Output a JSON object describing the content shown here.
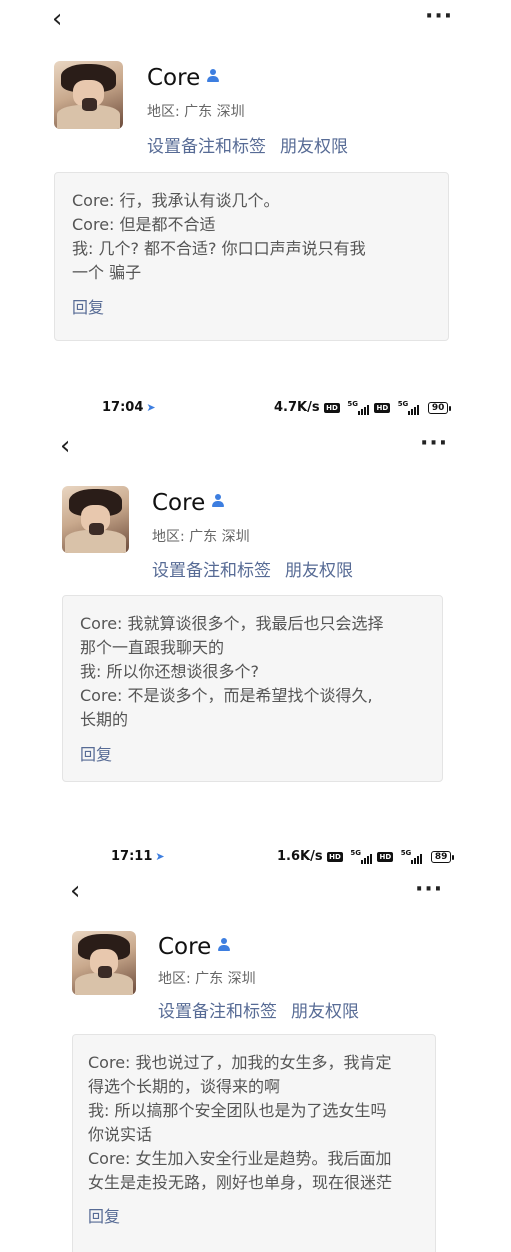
{
  "panels": [
    {
      "contact": {
        "name": "Core",
        "region": "地区: 广东  深圳",
        "set_remark": "设置备注和标签",
        "friend_permissions": "朋友权限"
      },
      "messages": [
        "Core: 行，我承认有谈几个。",
        "Core: 但是都不合适",
        "我: 几个? 都不合适? 你口口声声说只有我",
        "一个 骗子"
      ],
      "reply": "回复"
    },
    {
      "status": {
        "time": "17:04",
        "speed": "4.7K/s",
        "battery": "90"
      },
      "contact": {
        "name": "Core",
        "region": "地区: 广东  深圳",
        "set_remark": "设置备注和标签",
        "friend_permissions": "朋友权限"
      },
      "messages": [
        "Core: 我就算谈很多个，我最后也只会选择",
        "那个一直跟我聊天的",
        "我: 所以你还想谈很多个?",
        "Core: 不是谈多个，而是希望找个谈得久,",
        "长期的"
      ],
      "reply": "回复"
    },
    {
      "status": {
        "time": "17:11",
        "speed": "1.6K/s",
        "battery": "89"
      },
      "contact": {
        "name": "Core",
        "region": "地区: 广东  深圳",
        "set_remark": "设置备注和标签",
        "friend_permissions": "朋友权限"
      },
      "messages": [
        "Core: 我也说过了，加我的女生多，我肯定",
        "得选个长期的，谈得来的啊",
        "我: 所以搞那个安全团队也是为了选女生吗",
        "你说实话",
        "Core: 女生加入安全行业是趋势。我后面加",
        "女生是走投无路，刚好也单身，现在很迷茫"
      ],
      "reply": "回复"
    }
  ],
  "icons": {
    "back": "chevron-left-icon",
    "more": "more-dots-icon",
    "contact": "person-icon",
    "location": "location-arrow-icon",
    "signal": "signal-icon",
    "battery": "battery-icon"
  },
  "accent_colors": {
    "link": "#576b95",
    "person_icon": "#3d7ee0",
    "card_bg": "#f6f6f6"
  },
  "labels": {
    "more_dots": "···",
    "back_chevron": "‹",
    "network": "5G",
    "hd": "HD"
  }
}
